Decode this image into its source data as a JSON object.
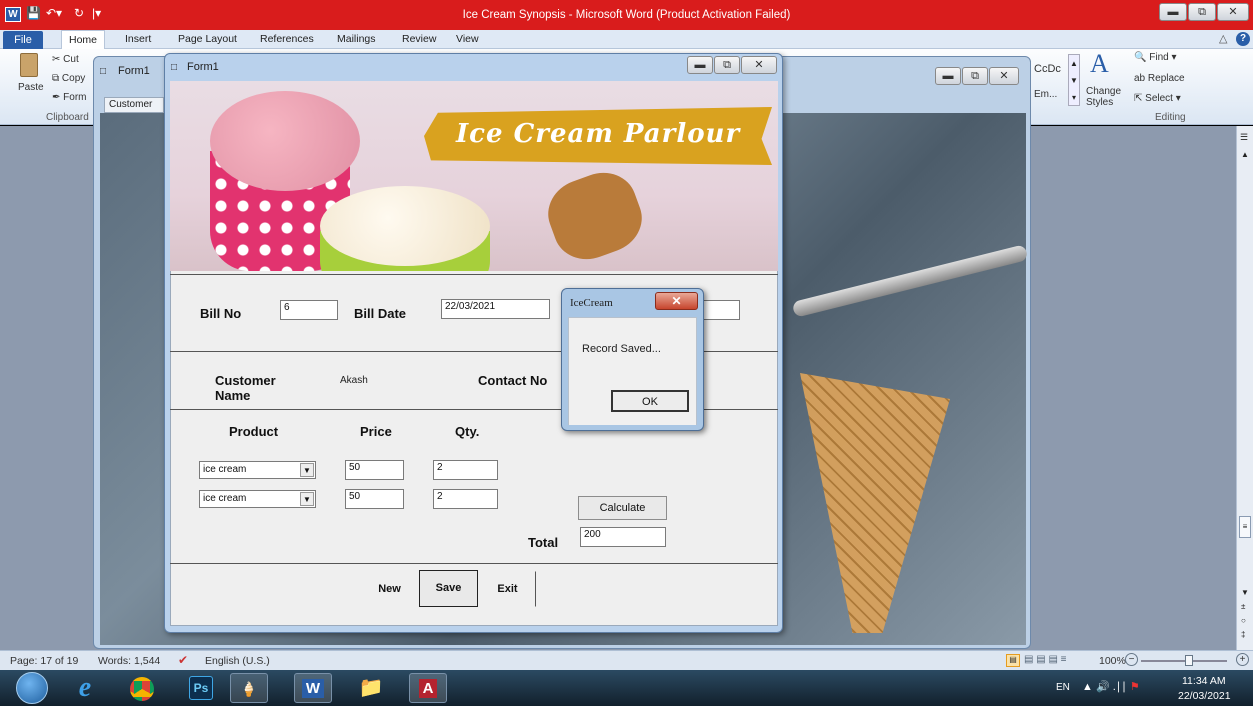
{
  "word": {
    "title": "Ice Cream Synopsis  -  Microsoft Word (Product Activation Failed)",
    "tabs": [
      "File",
      "Home",
      "Insert",
      "Page Layout",
      "References",
      "Mailings",
      "Review",
      "View"
    ],
    "clipboard": {
      "cut": "Cut",
      "copy": "Copy",
      "format": "Form",
      "paste": "Paste",
      "group": "Clipboard"
    },
    "styles_partial": {
      "c1": "CcDc",
      "c2": "Em..."
    },
    "change_styles": "Change Styles",
    "editing": {
      "find": "Find",
      "replace": "Replace",
      "select": "Select",
      "group": "Editing"
    },
    "status": {
      "page": "Page: 17 of 19",
      "words": "Words: 1,544",
      "lang": "English (U.S.)",
      "zoom": "100%"
    }
  },
  "back_form": {
    "title": "Form1",
    "tab": "Customer"
  },
  "form": {
    "title": "Form1",
    "banner": "Ice Cream Parlour",
    "bill_no_label": "Bill No",
    "bill_no": "6",
    "bill_date_label": "Bill Date",
    "bill_date": "22/03/2021",
    "customer_label": "Customer Name",
    "customer": "Akash",
    "contact_label": "Contact No",
    "product_label": "Product",
    "price_label": "Price",
    "qty_label": "Qty.",
    "rows": [
      {
        "product": "ice cream",
        "price": "50",
        "qty": "2"
      },
      {
        "product": "ice cream",
        "price": "50",
        "qty": "2"
      }
    ],
    "calculate": "Calculate",
    "total_label": "Total",
    "total": "200",
    "new": "New",
    "save": "Save",
    "exit": "Exit"
  },
  "dialog": {
    "title": "IceCream",
    "message": "Record Saved...",
    "ok": "OK"
  },
  "taskbar": {
    "lang": "EN",
    "time": "11:34 AM",
    "date": "22/03/2021"
  },
  "colors": {
    "titlebar": "#d91c1c",
    "banner_strip": "#d9a21f",
    "word_blue": "#2a5ea8"
  }
}
